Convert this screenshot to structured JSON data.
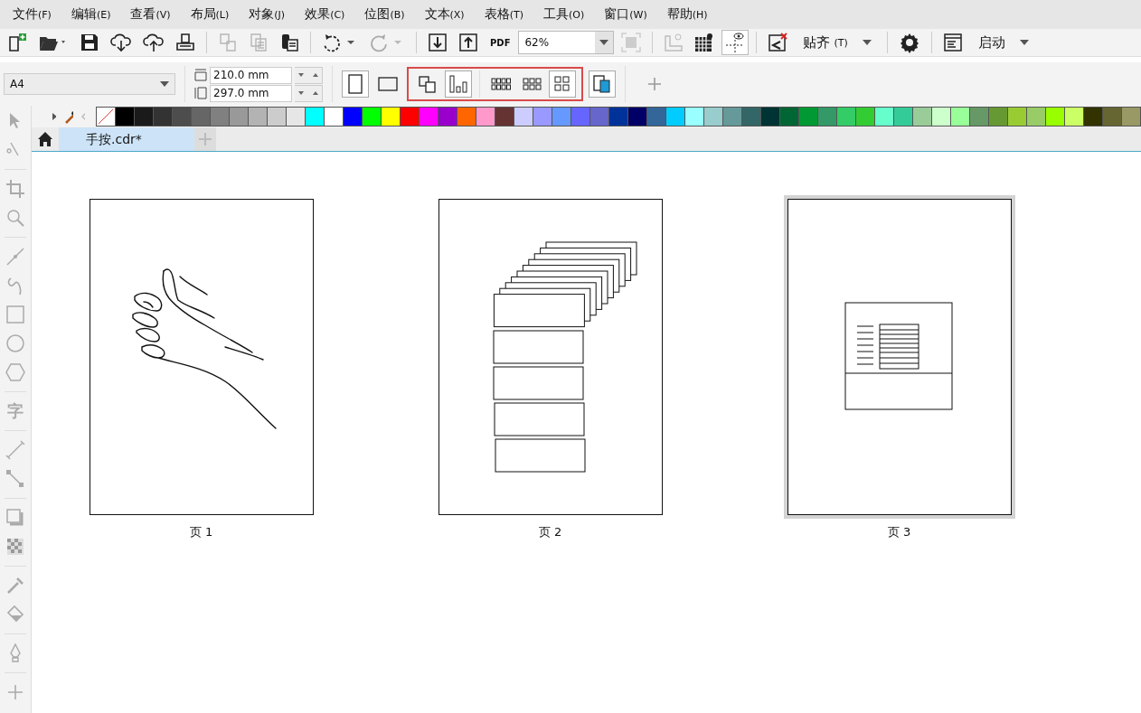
{
  "menu": [
    {
      "label": "文件",
      "key": "(F)"
    },
    {
      "label": "编辑",
      "key": "(E)"
    },
    {
      "label": "查看",
      "key": "(V)"
    },
    {
      "label": "布局",
      "key": "(L)"
    },
    {
      "label": "对象",
      "key": "(J)"
    },
    {
      "label": "效果",
      "key": "(C)"
    },
    {
      "label": "位图",
      "key": "(B)"
    },
    {
      "label": "文本",
      "key": "(X)"
    },
    {
      "label": "表格",
      "key": "(T)"
    },
    {
      "label": "工具",
      "key": "(O)"
    },
    {
      "label": "窗口",
      "key": "(W)"
    },
    {
      "label": "帮助",
      "key": "(H)"
    }
  ],
  "toolbar": {
    "buttons": [
      {
        "disabled": false
      },
      {
        "disabled": false
      },
      {
        "disabled": false
      },
      {
        "disabled": false
      },
      {
        "disabled": false
      },
      {
        "disabled": false
      },
      {
        "disabled": true
      },
      {
        "disabled": true
      },
      {
        "disabled": false
      },
      {
        "disabled": false
      },
      {
        "disabled": true
      },
      {
        "disabled": false
      },
      {
        "disabled": false
      },
      {
        "disabled": false
      },
      {
        "disabled": true
      },
      {
        "disabled": true
      },
      {
        "disabled": false
      },
      {
        "disabled": false
      },
      {
        "disabled": false
      },
      {
        "disabled": false
      },
      {
        "disabled": false
      }
    ],
    "pdf_label": "PDF",
    "zoom": "62%",
    "snap_label": "贴齐",
    "snap_key": "(T)",
    "launch_label": "启动"
  },
  "property_bar": {
    "page_size": "A4",
    "width": "210.0 mm",
    "height": "297.0 mm",
    "orientation": [
      {
        "selected": true
      },
      {
        "selected": false
      }
    ],
    "layout_buttons": [
      {
        "selected": false
      },
      {
        "selected": true
      },
      {
        "selected": false
      },
      {
        "selected": false
      },
      {
        "selected": true
      },
      {
        "selected": true
      }
    ]
  },
  "palette": [
    {
      "color": "#000000"
    },
    {
      "color": "#1a1a1a"
    },
    {
      "color": "#333333"
    },
    {
      "color": "#4d4d4d"
    },
    {
      "color": "#666666"
    },
    {
      "color": "#808080"
    },
    {
      "color": "#999999"
    },
    {
      "color": "#b3b3b3"
    },
    {
      "color": "#cccccc"
    },
    {
      "color": "#e6e6e6"
    },
    {
      "color": "#00ffff"
    },
    {
      "color": "#ffffff"
    },
    {
      "color": "#0000ff"
    },
    {
      "color": "#00ff00"
    },
    {
      "color": "#ffff00"
    },
    {
      "color": "#ff0000"
    },
    {
      "color": "#ff00ff"
    },
    {
      "color": "#9900cc"
    },
    {
      "color": "#ff6600"
    },
    {
      "color": "#ff99cc"
    },
    {
      "color": "#663333"
    },
    {
      "color": "#ccccff"
    },
    {
      "color": "#9999ff"
    },
    {
      "color": "#6699ff"
    },
    {
      "color": "#6666ff"
    },
    {
      "color": "#6666cc"
    },
    {
      "color": "#003399"
    },
    {
      "color": "#000066"
    },
    {
      "color": "#336699"
    },
    {
      "color": "#00ccff"
    },
    {
      "color": "#99ffff"
    },
    {
      "color": "#99cccc"
    },
    {
      "color": "#669999"
    },
    {
      "color": "#336666"
    },
    {
      "color": "#003333"
    },
    {
      "color": "#006633"
    },
    {
      "color": "#009933"
    },
    {
      "color": "#339966"
    },
    {
      "color": "#33cc66"
    },
    {
      "color": "#33cc33"
    },
    {
      "color": "#66ffcc"
    },
    {
      "color": "#33cc99"
    },
    {
      "color": "#99cc99"
    },
    {
      "color": "#ccffcc"
    },
    {
      "color": "#99ff99"
    },
    {
      "color": "#669966"
    },
    {
      "color": "#669933"
    },
    {
      "color": "#99cc33"
    },
    {
      "color": "#99cc66"
    },
    {
      "color": "#99ff00"
    },
    {
      "color": "#ccff66"
    },
    {
      "color": "#333300"
    },
    {
      "color": "#666633"
    },
    {
      "color": "#999966"
    }
  ],
  "toolbox": {
    "text_tool_glyph": "字"
  },
  "tabs": [
    {
      "title": "手按.cdr*",
      "selected": true
    }
  ],
  "pages": [
    {
      "label": "页 1",
      "kind": "hand",
      "selected": false
    },
    {
      "label": "页 2",
      "kind": "stack",
      "selected": false
    },
    {
      "label": "页 3",
      "kind": "layout",
      "selected": true
    }
  ]
}
